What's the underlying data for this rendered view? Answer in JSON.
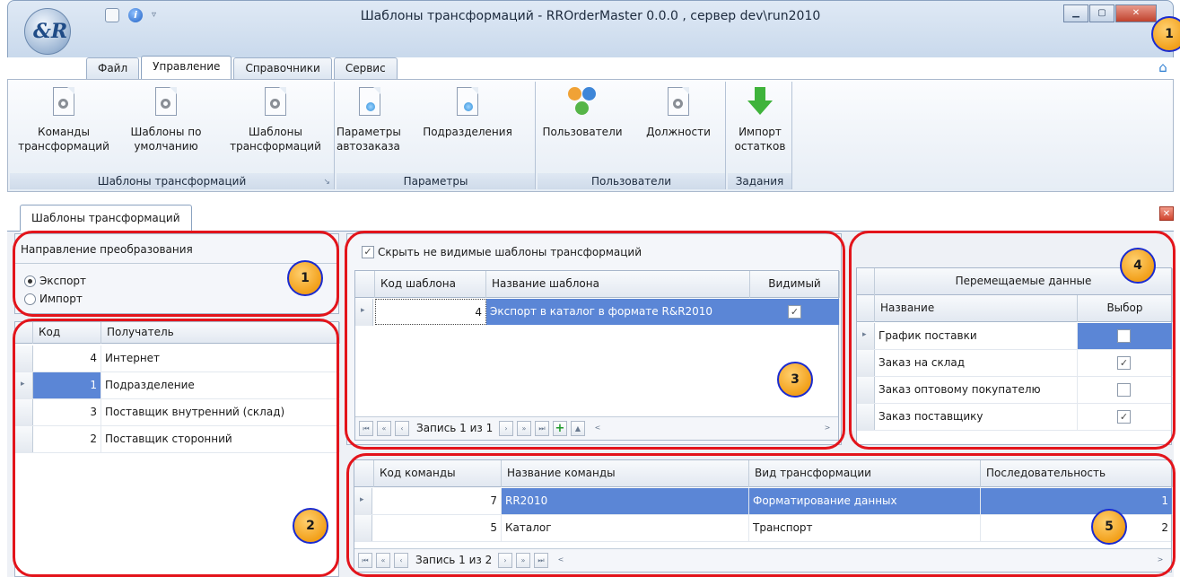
{
  "window": {
    "title": "Шаблоны трансформаций - RROrderMaster 0.0.0 , сервер dev\\run2010",
    "logo_text": "&R",
    "controls": {
      "minimize": "▁",
      "maximize": "▢",
      "close": "✕"
    },
    "qat_help": "i",
    "qat_dropdown": "▿"
  },
  "menu": {
    "tabs": [
      {
        "label": "Файл"
      },
      {
        "label": "Управление"
      },
      {
        "label": "Справочники"
      },
      {
        "label": "Сервис"
      }
    ],
    "active_index": 1
  },
  "ribbon": {
    "groups": [
      {
        "caption": "Шаблоны трансформаций",
        "buttons": [
          "Команды\nтрансформаций",
          "Шаблоны по\nумолчанию",
          "Шаблоны\nтрансформаций"
        ]
      },
      {
        "caption": "Параметры",
        "buttons": [
          "Параметры\nавтозаказа",
          "Подразделения"
        ]
      },
      {
        "caption": "Пользователи",
        "buttons": [
          "Пользователи",
          "Должности"
        ]
      },
      {
        "caption": "Задания",
        "buttons": [
          "Импорт\nостатков"
        ]
      }
    ],
    "launcher": "↘"
  },
  "document_tab": {
    "label": "Шаблоны трансформаций",
    "close": "✕"
  },
  "callouts": [
    "1",
    "2",
    "3",
    "4",
    "5",
    "1"
  ],
  "direction": {
    "title": "Направление преобразования",
    "options": [
      {
        "label": "Экспорт",
        "checked": true
      },
      {
        "label": "Импорт",
        "checked": false
      }
    ]
  },
  "recipients": {
    "columns": [
      "Код",
      "Получатель"
    ],
    "rows": [
      {
        "code": "4",
        "name": "Интернет",
        "selected": false
      },
      {
        "code": "1",
        "name": "Подразделение",
        "selected": true
      },
      {
        "code": "3",
        "name": "Поставщик внутренний (склад)",
        "selected": false
      },
      {
        "code": "2",
        "name": "Поставщик сторонний",
        "selected": false
      }
    ]
  },
  "templates": {
    "hide_label": "Скрыть не видимые шаблоны трансформаций",
    "hide_checked": true,
    "columns": [
      "Код шаблона",
      "Название шаблона",
      "Видимый"
    ],
    "rows": [
      {
        "code": "4",
        "name": "Экспорт в каталог в формате  R&R2010",
        "visible": true
      }
    ],
    "nav_text": "Запись 1 из 1"
  },
  "moved_data": {
    "group_header": "Перемещаемые данные",
    "columns": [
      "Название",
      "Выбор"
    ],
    "rows": [
      {
        "name": "График поставки",
        "checked": false
      },
      {
        "name": "Заказ на склад",
        "checked": true
      },
      {
        "name": "Заказ оптовому покупателю",
        "checked": false
      },
      {
        "name": "Заказ поставщику",
        "checked": true
      }
    ]
  },
  "commands": {
    "columns": [
      "Код команды",
      "Название команды",
      "Вид трансформации",
      "Последовательность"
    ],
    "rows": [
      {
        "code": "7",
        "name": "RR2010",
        "type": "Форматирование данных",
        "seq": "1"
      },
      {
        "code": "5",
        "name": "Каталог",
        "type": "Транспорт",
        "seq": "2"
      }
    ],
    "nav_text": "Запись 1 из 2"
  },
  "nav_glyphs": {
    "first": "⏮",
    "prev_page": "«",
    "prev": "‹",
    "next": "›",
    "next_page": "»",
    "last": "⏭",
    "add": "+",
    "up": "▲",
    "scroll_left": "<",
    "scroll_right": ">"
  },
  "check_glyph": "✓",
  "home_glyph": "⌂"
}
